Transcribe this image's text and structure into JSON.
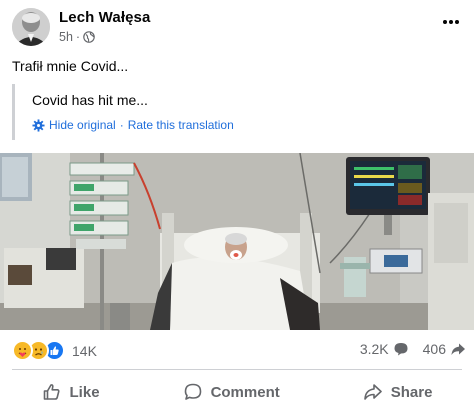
{
  "post": {
    "author": "Lech Wałęsa",
    "timestamp": "5h",
    "privacy_icon": "globe-icon",
    "text": "Trafił mnie Covid...",
    "translation": {
      "text": "Covid has hit me...",
      "hide_label": "Hide original",
      "separator": "·",
      "rate_label": "Rate this translation"
    },
    "photo_alt": "photo"
  },
  "engagement": {
    "reactions_count": "14K",
    "reaction_icons": [
      "care-reaction-icon",
      "sad-reaction-icon",
      "like-reaction-icon"
    ],
    "comments_count": "3.2K",
    "shares_count": "406"
  },
  "actions": {
    "like": "Like",
    "comment": "Comment",
    "share": "Share"
  },
  "colors": {
    "link": "#216fdb",
    "muted": "#65676b",
    "like_blue": "#1877f2",
    "reaction_yellow": "#f7b928"
  }
}
